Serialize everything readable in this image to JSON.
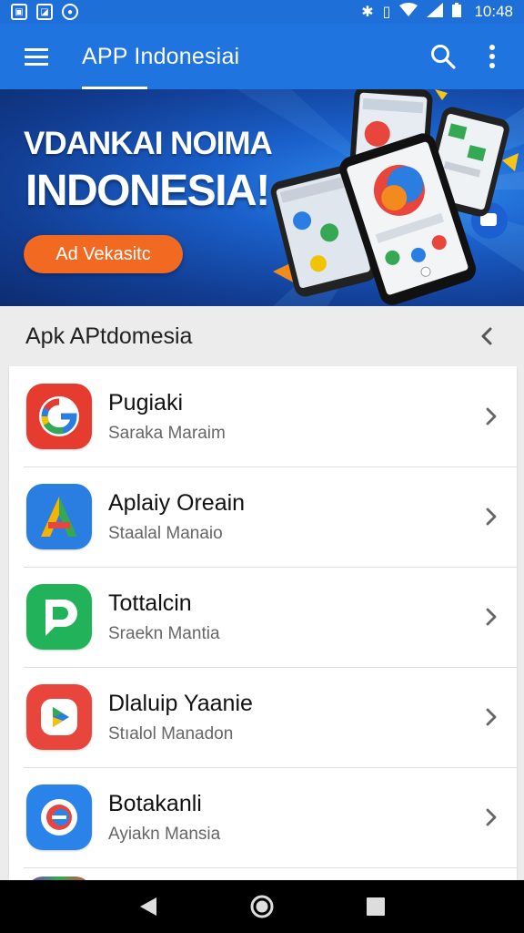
{
  "status_bar": {
    "time": "10:48",
    "left_icons": [
      "gallery-icon",
      "image-icon",
      "notification-circle-icon"
    ],
    "right_icons": [
      "bluetooth-icon",
      "vibrate-icon",
      "wifi-icon",
      "signal-icon",
      "battery-icon"
    ]
  },
  "app_bar": {
    "title": "APP Indonesiai",
    "icons": [
      "menu-icon",
      "search-icon",
      "more-vert-icon"
    ]
  },
  "banner": {
    "headline_1": "VDANKAI NOIMA",
    "headline_2": "INDONESIA!",
    "cta_label": "Ad Vekasitc"
  },
  "section": {
    "title": "Apk APtdomesia"
  },
  "apps": [
    {
      "name": "Pugiaki",
      "subtitle": "Saraka Maraim",
      "icon": "g-logo-icon",
      "colors": [
        "#e53c2f",
        "#f0c400",
        "#35a853"
      ]
    },
    {
      "name": "Aplaiy Oreain",
      "subtitle": "Staalal Manaio",
      "icon": "a-logo-icon",
      "colors": [
        "#2a7de1",
        "#f5b400",
        "#34a853"
      ]
    },
    {
      "name": "Tottalcin",
      "subtitle": "Sraekn Mantia",
      "icon": "chat-d-icon",
      "colors": [
        "#22b35a"
      ]
    },
    {
      "name": "Dlaluip Yaanie",
      "subtitle": "Stıalol Manadon",
      "icon": "play-icon",
      "colors": [
        "#e8453c",
        "#ffffff"
      ]
    },
    {
      "name": "Botakanli",
      "subtitle": "Ayiakn Mansia",
      "icon": "circle-e-icon",
      "colors": [
        "#2a83e8",
        "#e8453c"
      ]
    }
  ],
  "colors": {
    "primary": "#1f74e0",
    "status_bar": "#1f6fd8",
    "cta": "#f26a22",
    "background": "#ececec"
  },
  "nav_bar": {
    "icons": [
      "back-triangle-icon",
      "home-circle-icon",
      "recents-square-icon"
    ]
  }
}
